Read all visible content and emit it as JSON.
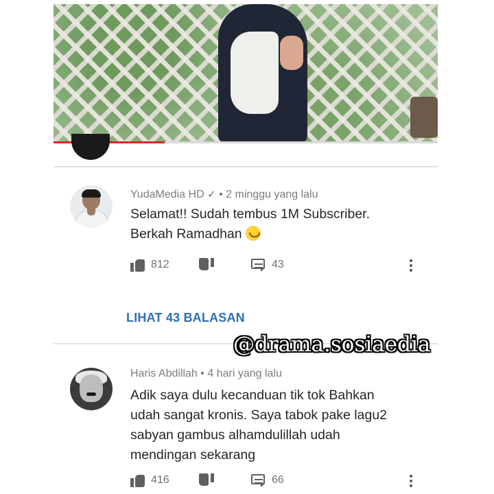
{
  "video": {
    "progress_fraction": 0.29,
    "progress_color": "#e0281f"
  },
  "comments": [
    {
      "author": "YudaMedia HD",
      "verified_icon": "checkmark-icon",
      "verified_mark": "✓",
      "separator": "•",
      "time": "2 minggu yang lalu",
      "text_lines": [
        "Selamat!! Sudah tembus 1M Subscriber.",
        "Berkah Ramadhan"
      ],
      "emoji": "smiling-face-emoji",
      "likes": "812",
      "replies": "43"
    },
    {
      "author": "Haris Abdillah",
      "separator": "•",
      "time": "4 hari yang lalu",
      "text_lines": [
        "Adik saya dulu kecanduan tik tok  Bahkan",
        "udah sangat kronis. Saya tabok pake lagu2",
        "sabyan gambus alhamdulillah udah",
        "mendingan sekarang"
      ],
      "likes": "416",
      "replies": "66"
    }
  ],
  "view_replies_label": "LIHAT 43 BALASAN",
  "watermark": "@drama.sosiaedia",
  "colors": {
    "link": "#2f6fb5",
    "text": "#252525",
    "meta": "#7c7c7c"
  }
}
